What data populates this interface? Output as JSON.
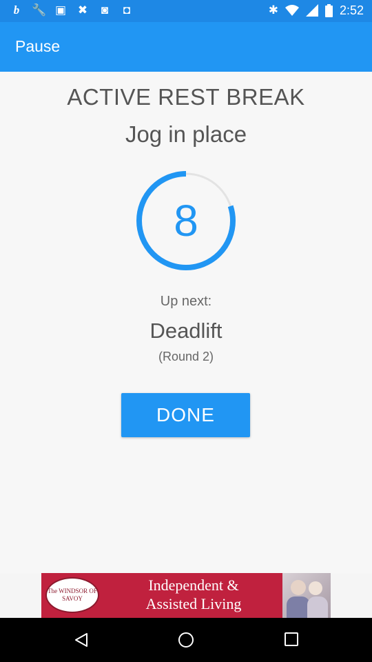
{
  "status_bar": {
    "icons": [
      "b-app-icon",
      "wrench-icon",
      "image-icon",
      "tools-icon",
      "bag-icon",
      "robot-icon"
    ],
    "right_icons": [
      "bluetooth-icon",
      "wifi-icon",
      "signal-icon",
      "battery-icon"
    ],
    "time": "2:52"
  },
  "app_bar": {
    "title": "Pause"
  },
  "main": {
    "heading": "ACTIVE REST BREAK",
    "exercise": "Jog in place",
    "timer": {
      "value": "8",
      "progress_fraction": 0.8
    },
    "up_next_label": "Up next:",
    "up_next_name": "Deadlift",
    "up_next_round": "(Round 2)",
    "done_label": "DONE"
  },
  "ad": {
    "logo_text": "The WINDSOR OF SAVOY",
    "line1": "Independent &",
    "line2": "Assisted Living"
  },
  "colors": {
    "primary": "#2196f3",
    "status_bar": "#1e88e5",
    "track": "#e3e3e3",
    "ad_background": "#c0213e"
  }
}
